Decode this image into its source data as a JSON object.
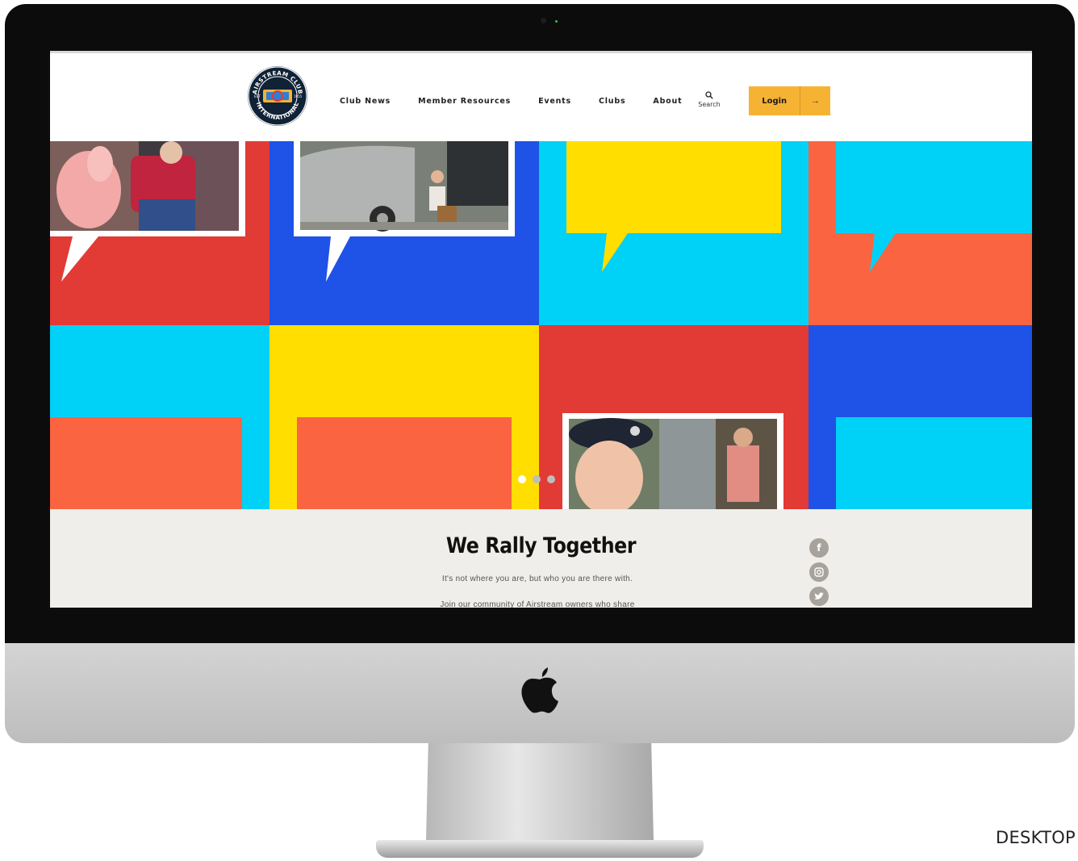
{
  "nav": {
    "items": [
      "Club News",
      "Member Resources",
      "Events",
      "Clubs",
      "About"
    ],
    "search_label": "Search",
    "login_label": "Login",
    "login_arrow": "→"
  },
  "logo": {
    "top_text": "AIRSTREAM CLUB",
    "bottom_text": "INTERNATIONAL",
    "left_text": "EST",
    "right_text": "1955"
  },
  "hero": {
    "slides": 3,
    "active_slide": 1
  },
  "intro": {
    "title": "We Rally Together",
    "line1": "It's not where you are, but who you are there with.",
    "line2": "Join our community of Airstream owners who share"
  },
  "social": [
    "facebook-icon",
    "instagram-icon",
    "twitter-icon"
  ],
  "colors": {
    "red": "#e23a35",
    "blue": "#1f52e6",
    "cyan": "#00d1f6",
    "yellow": "#ffde00",
    "orange": "#fb6441",
    "login": "#f6b333",
    "intro_bg": "#efeeea"
  },
  "caption": "DESKTOP"
}
